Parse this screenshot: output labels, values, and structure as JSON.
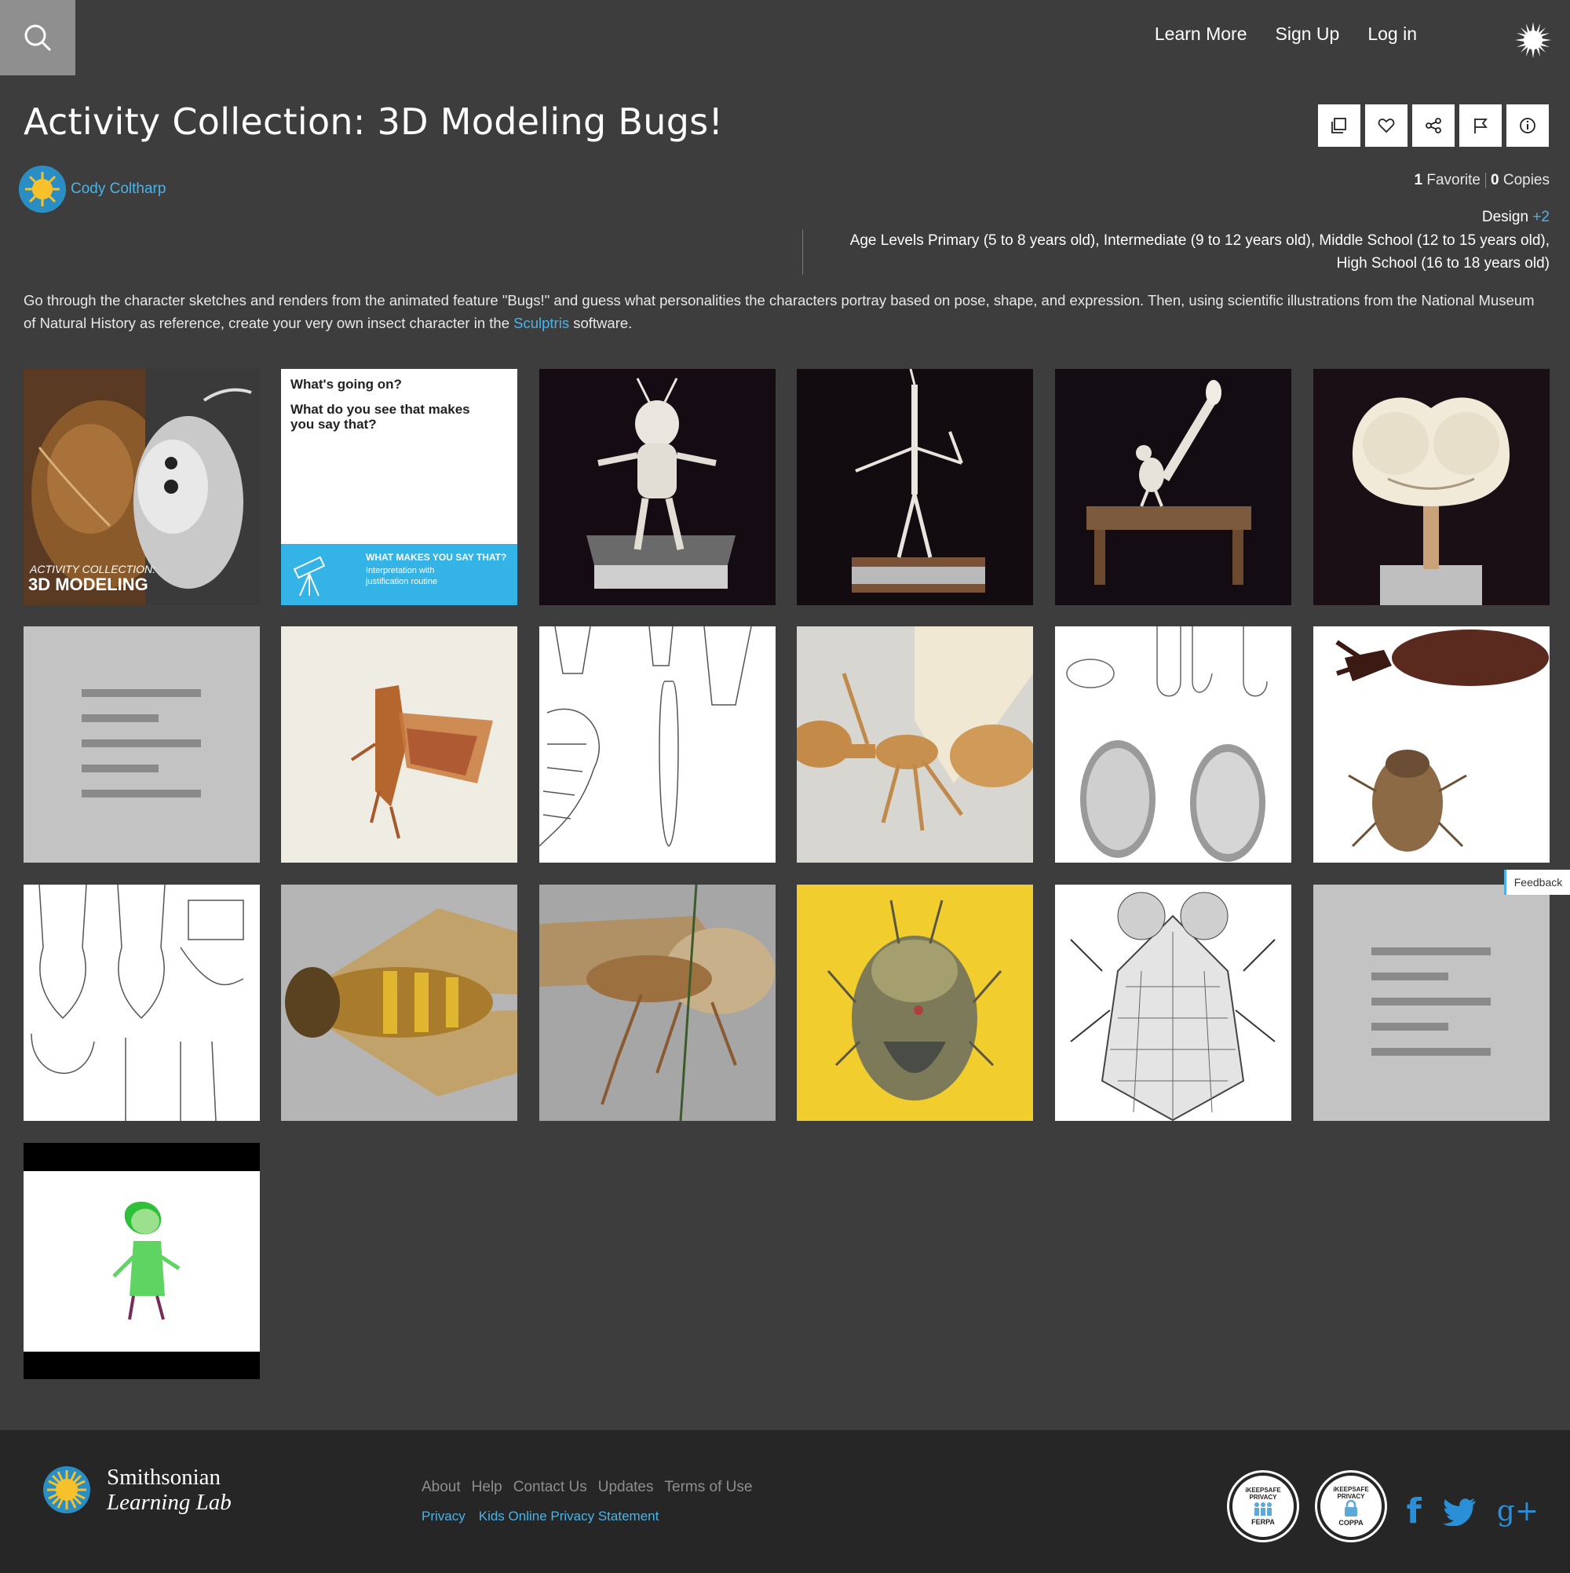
{
  "nav": {
    "learn_more": "Learn More",
    "sign_up": "Sign Up",
    "log_in": "Log in"
  },
  "page": {
    "title": "Activity Collection: 3D Modeling Bugs!",
    "author": "Cody Coltharp",
    "favorites_count": "1",
    "favorites_label": "Favorite",
    "copies_count": "0",
    "copies_label": "Copies",
    "subject": "Design",
    "subject_more": "+2",
    "age_levels": "Age Levels Primary (5 to 8 years old), Intermediate (9 to 12 years old), Middle School (12 to 15 years old), High School (16 to 18 years old)",
    "description_before": "Go through the character sketches and renders from the animated feature \"Bugs!\" and guess what personalities the characters portray based on pose, shape, and expression. Then, using scientific illustrations from the National Museum of Natural History as reference, create your very own insect character in the ",
    "description_link": "Sculptris",
    "description_after": " software."
  },
  "tiles": {
    "t1_small": "ACTIVITY COLLECTION:",
    "t1_big": "3D MODELING",
    "t2_q1": "What's going on?",
    "t2_q2a": "What do you see that makes",
    "t2_q2b": "you say that?",
    "t2_banner_title": "WHAT MAKES YOU SAY THAT?",
    "t2_banner_sub1": "Interpretation with",
    "t2_banner_sub2": "justification routine"
  },
  "feedback": "Feedback",
  "footer": {
    "brand_line1": "Smithsonian",
    "brand_line2": "Learning Lab",
    "links": [
      "About",
      "Help",
      "Contact Us",
      "Updates",
      "Terms of Use"
    ],
    "links2": [
      "Privacy",
      "Kids Online Privacy Statement"
    ],
    "badge_ferpa_top": "iKEEPSAFE PRIVACY",
    "badge_ferpa_bottom": "FERPA",
    "badge_coppa_top": "iKEEPSAFE PRIVACY",
    "badge_coppa_bottom": "COPPA"
  },
  "icons": [
    "search-icon",
    "sun-logo-icon",
    "copy-icon",
    "heart-icon",
    "share-icon",
    "flag-icon",
    "info-icon",
    "facebook-icon",
    "twitter-icon",
    "google-plus-icon"
  ],
  "colors": {
    "background": "#3d3d3d",
    "link": "#4ab3e8",
    "footer": "#262626"
  }
}
